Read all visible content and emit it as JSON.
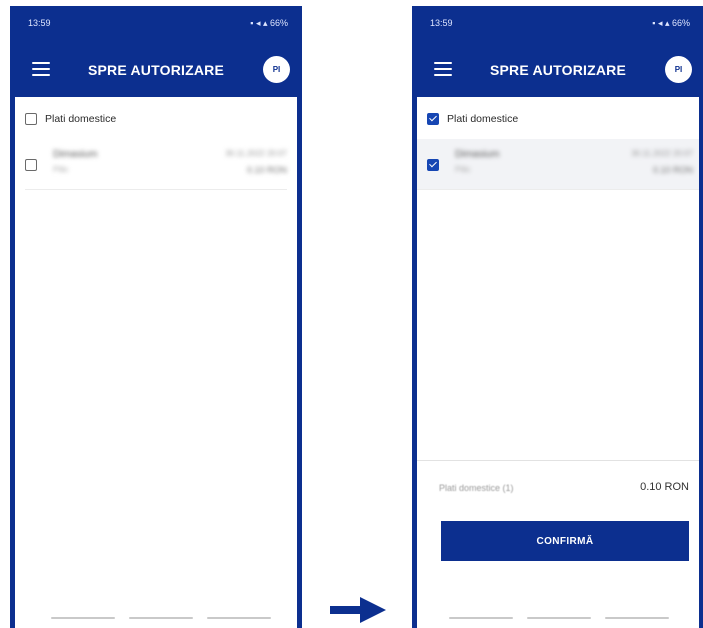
{
  "status_bar": {
    "time": "13:59",
    "icons_text": "66%"
  },
  "app": {
    "title": "SPRE AUTORIZARE",
    "avatar_initials": "PI"
  },
  "group": {
    "label": "Plati domestice"
  },
  "transaction": {
    "name": "Dimasium",
    "sub": "Plăc",
    "date": "30.11.2022 20:07",
    "amount": "0.10 RON"
  },
  "summary": {
    "label": "Plati domestice (1)",
    "value": "0.10 RON"
  },
  "confirm": {
    "label": "CONFIRMĂ"
  },
  "colors": {
    "brand": "#0c2f8f",
    "checkbox_checked": "#1646b3"
  },
  "states": {
    "left_selected": false,
    "right_selected": true
  }
}
